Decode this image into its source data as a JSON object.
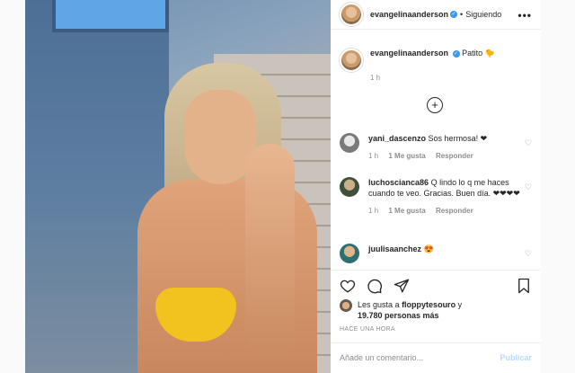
{
  "header": {
    "username": "evangelinaanderson",
    "separator": "•",
    "follow_status": "Siguiendo",
    "more": "•••"
  },
  "caption": {
    "username": "evangelinaanderson",
    "text": "Patito 🐤",
    "time": "1 h"
  },
  "load_more": "+",
  "comments": [
    {
      "username": "yani_dascenzo",
      "text": "Sos hermosa! ❤",
      "time": "1 h",
      "likes": "1 Me gusta",
      "reply": "Responder"
    },
    {
      "username": "luchoscianca86",
      "text": "Q lindo lo q me haces cuando te veo. Gracias. Buen día. ❤❤❤❤",
      "time": "1 h",
      "likes": "1 Me gusta",
      "reply": "Responder"
    },
    {
      "username": "juulisaanchez",
      "text": "😍",
      "time": "",
      "likes": "",
      "reply": ""
    }
  ],
  "likes": {
    "prefix": "Les gusta a",
    "first_user": "floppytesouro",
    "conj": "y",
    "others": "19.780 personas más"
  },
  "posted_ago": "HACE UNA HORA",
  "add_comment": {
    "placeholder": "Añade un comentario...",
    "submit": "Publicar"
  },
  "colors": {
    "verified": "#3897f0",
    "publish_disabled": "#b3dbff",
    "secondary_text": "#8e8e8e"
  }
}
